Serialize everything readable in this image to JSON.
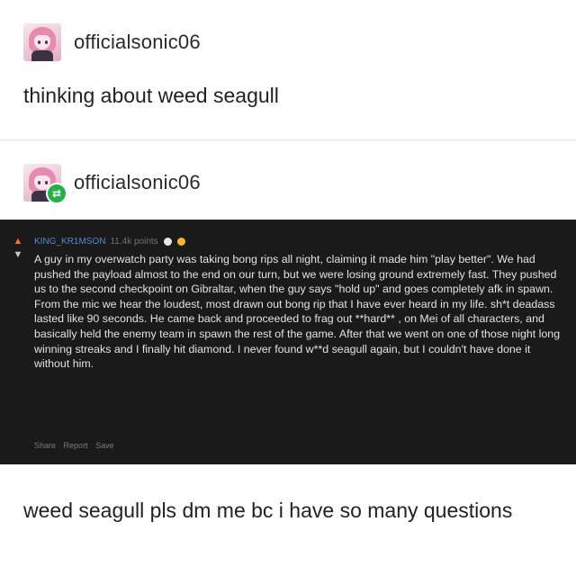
{
  "post1": {
    "username": "officialsonic06",
    "text": "thinking about weed seagull"
  },
  "post2": {
    "username": "officialsonic06",
    "reblog_icon": "reblog-icon"
  },
  "comment": {
    "author": "KING_KR1MSON",
    "points": "11.4k points",
    "body": "A guy in my overwatch party was taking bong rips all night, claiming it made him \"play better\". We had pushed the payload almost to the end on our turn, but we were losing ground extremely fast. They pushed us to the second checkpoint on Gibraltar, when the guy says \"hold up\" and goes completely afk in spawn. From the mic we hear the loudest, most drawn out bong rip that I have ever heard in my life. sh*t deadass lasted like 90 seconds. He came back and proceeded to frag out **hard** , on Mei of all characters, and basically held the enemy team in spawn the rest of the game. After that we went on one of those night long winning streaks and I finally hit diamond. I never found w**d seagull again, but I couldn't have done it without him.",
    "actions": [
      "Share",
      "Report",
      "Save"
    ],
    "colors": {
      "background": "#1a1a1b",
      "author": "#4f8bd6",
      "upvote": "#ff6b2b"
    }
  },
  "reply": {
    "text": "weed seagull pls dm me bc i have so many questions"
  }
}
